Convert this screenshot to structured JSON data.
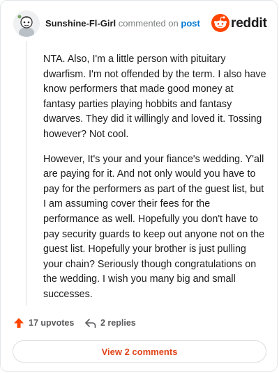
{
  "header": {
    "username": "Sunshine-Fl-Girl",
    "commented_text": "commented on",
    "post_link": "post",
    "brand": "reddit"
  },
  "comment": {
    "paragraphs": [
      "NTA. Also, I'm a little person with pituitary dwarfism. I'm not offended by the term. I also have know performers that made good money at fantasy parties playing hobbits and fantasy dwarves. They did it willingly and loved it. Tossing however? Not cool.",
      "However, It's your and your fiance's wedding. Y'all are paying for it. And not only would you have to pay for the performers as part of the guest list, but I am assuming cover their fees for the performance as well. Hopefully you don't have to pay security guards to keep out anyone not on the guest list. Hopefully your brother is just pulling your chain? Seriously though congratulations on the wedding. I wish you many big and small successes."
    ]
  },
  "actions": {
    "upvotes": "17 upvotes",
    "replies": "2 replies"
  },
  "view_comments": "View 2 comments",
  "colors": {
    "accent": "#ff4500",
    "link": "#0079d3",
    "view_button_text": "#e0451b"
  },
  "icons": [
    "avatar-character",
    "reddit-snoo-icon",
    "upvote-arrow-icon",
    "reply-arrow-icon"
  ]
}
